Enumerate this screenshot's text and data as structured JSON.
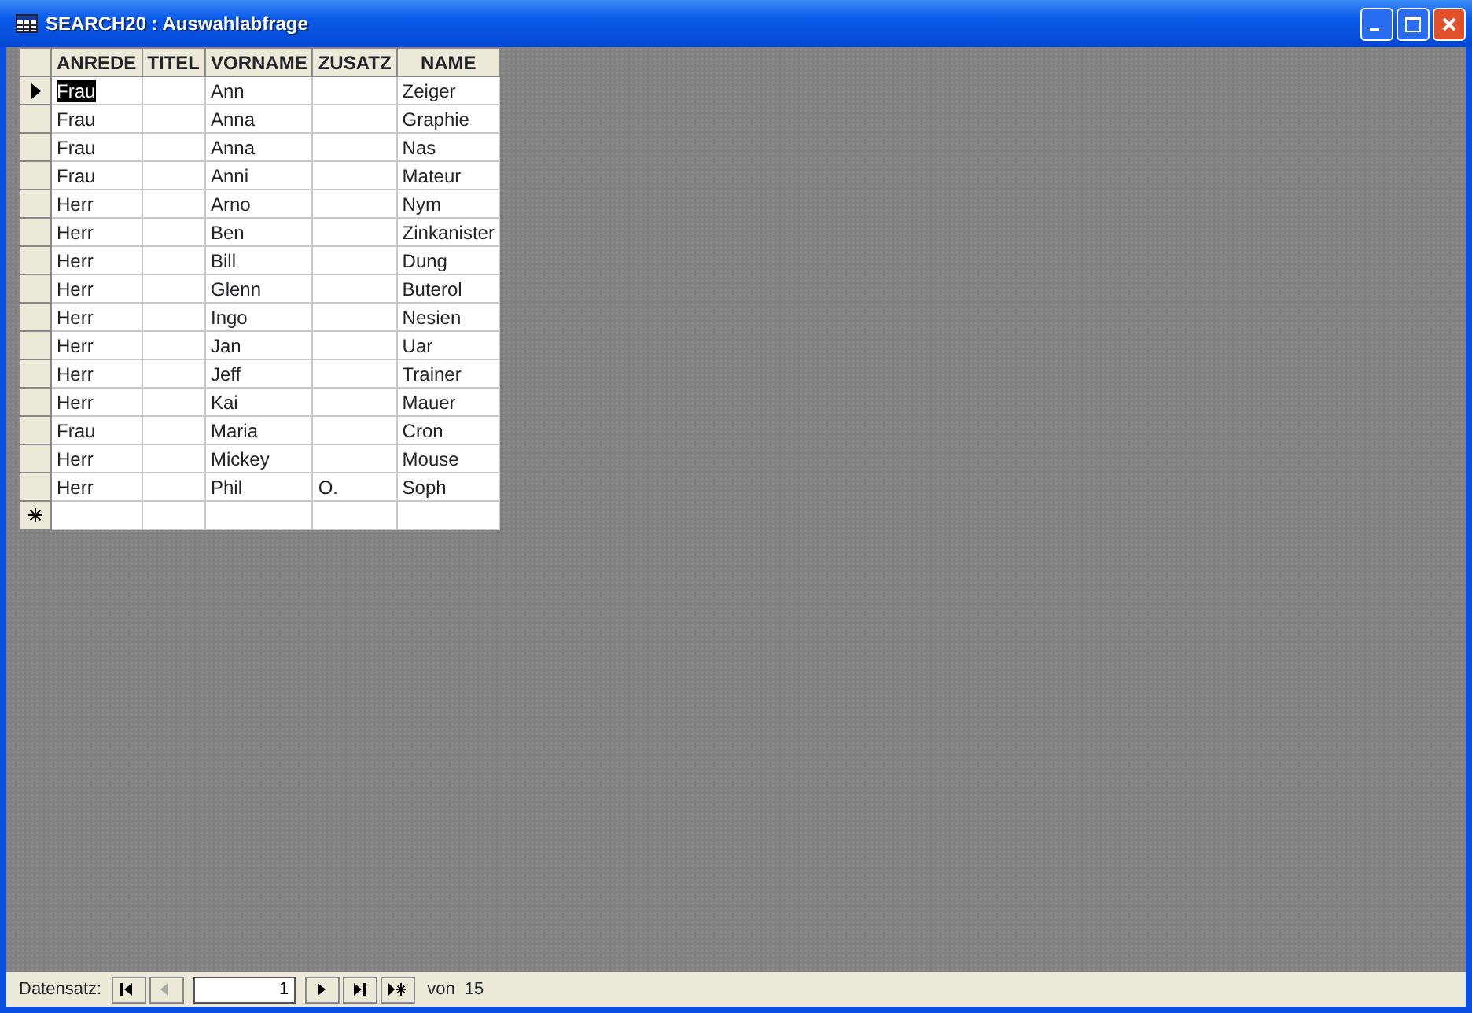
{
  "window": {
    "title": "SEARCH20 : Auswahlabfrage"
  },
  "table": {
    "columns": [
      "ANREDE",
      "TITEL",
      "VORNAME",
      "ZUSATZ",
      "NAME"
    ],
    "rows": [
      {
        "cells": [
          "Frau",
          "",
          "Ann",
          "",
          "Zeiger"
        ],
        "selected": true
      },
      {
        "cells": [
          "Frau",
          "",
          "Anna",
          "",
          "Graphie"
        ],
        "selected": false
      },
      {
        "cells": [
          "Frau",
          "",
          "Anna",
          "",
          "Nas"
        ],
        "selected": false
      },
      {
        "cells": [
          "Frau",
          "",
          "Anni",
          "",
          "Mateur"
        ],
        "selected": false
      },
      {
        "cells": [
          "Herr",
          "",
          "Arno",
          "",
          "Nym"
        ],
        "selected": false
      },
      {
        "cells": [
          "Herr",
          "",
          "Ben",
          "",
          "Zinkanister"
        ],
        "selected": false
      },
      {
        "cells": [
          "Herr",
          "",
          "Bill",
          "",
          "Dung"
        ],
        "selected": false
      },
      {
        "cells": [
          "Herr",
          "",
          "Glenn",
          "",
          "Buterol"
        ],
        "selected": false
      },
      {
        "cells": [
          "Herr",
          "",
          "Ingo",
          "",
          "Nesien"
        ],
        "selected": false
      },
      {
        "cells": [
          "Herr",
          "",
          "Jan",
          "",
          "Uar"
        ],
        "selected": false
      },
      {
        "cells": [
          "Herr",
          "",
          "Jeff",
          "",
          "Trainer"
        ],
        "selected": false
      },
      {
        "cells": [
          "Herr",
          "",
          "Kai",
          "",
          "Mauer"
        ],
        "selected": false
      },
      {
        "cells": [
          "Frau",
          "",
          "Maria",
          "",
          "Cron"
        ],
        "selected": false
      },
      {
        "cells": [
          "Herr",
          "",
          "Mickey",
          "",
          "Mouse"
        ],
        "selected": false
      },
      {
        "cells": [
          "Herr",
          "",
          "Phil",
          "O.",
          "Soph"
        ],
        "selected": false
      }
    ]
  },
  "navigator": {
    "label": "Datensatz:",
    "record": "1",
    "count": "von  15",
    "buttons": [
      {
        "kind": "first",
        "disabled": false
      },
      {
        "kind": "prev",
        "disabled": true
      },
      {
        "kind": "next",
        "disabled": false
      },
      {
        "kind": "last",
        "disabled": false
      },
      {
        "kind": "new",
        "disabled": false
      }
    ]
  }
}
